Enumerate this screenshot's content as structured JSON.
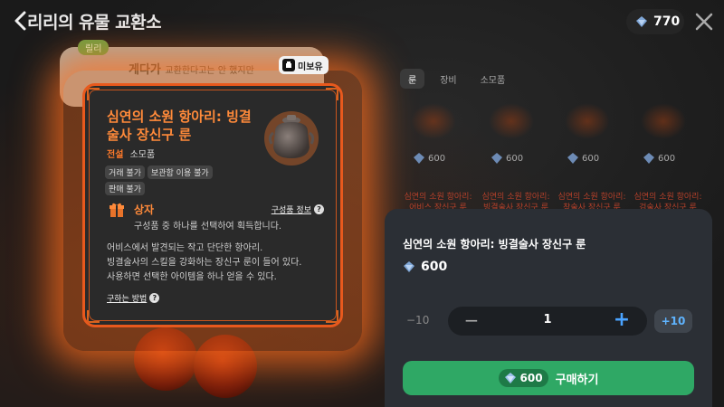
{
  "header": {
    "title": "리리의 유물 교환소",
    "currency_amount": "770"
  },
  "npc": {
    "tag": "릴리",
    "name": "게다가",
    "line": "교환한다고는 안 했지만"
  },
  "owned_badge": "미보유",
  "item_card": {
    "name": "심연의 소원 항아리: 빙결술사 장신구 룬",
    "grade": "전설",
    "category": "소모품",
    "tags": [
      "거래 불가",
      "보관함 이용 불가",
      "판매 불가"
    ],
    "box_title": "상자",
    "composition_link": "구성품 정보",
    "box_desc": "구성품 중 하나를 선택하여 획득합니다.",
    "description": [
      "어비스에서 발견되는 작고 단단한 항아리.",
      "빙결술사의 스킬을 강화하는 장신구 룬이 들어 있다.",
      "사용하면 선택한 아이템을 하나 얻을 수 있다."
    ],
    "how_to_get": "구하는 방법"
  },
  "shop": {
    "tabs": [
      "룬",
      "장비",
      "소모품"
    ],
    "items": [
      {
        "price": "600",
        "name": "심연의 소원 항아리: 어비스 장신구 룬"
      },
      {
        "price": "600",
        "name": "심연의 소원 항아리: 빙결술사 장신구 룬"
      },
      {
        "price": "600",
        "name": "심연의 소원 항아리: 창술사 장신구 룬"
      },
      {
        "price": "600",
        "name": "심연의 소원 항아리: 검술사 장신구 룬"
      }
    ]
  },
  "purchase": {
    "item_name": "심연의 소원 항아리: 빙결술사 장신구 룬",
    "price": "600",
    "minus10": "−10",
    "quantity": "1",
    "plus10": "+10",
    "buy_price": "600",
    "buy_label": "구매하기"
  },
  "colors": {
    "accent_orange": "#ff8a3a",
    "buy_green": "#2fa865",
    "plus_blue": "#4aa3ff"
  }
}
